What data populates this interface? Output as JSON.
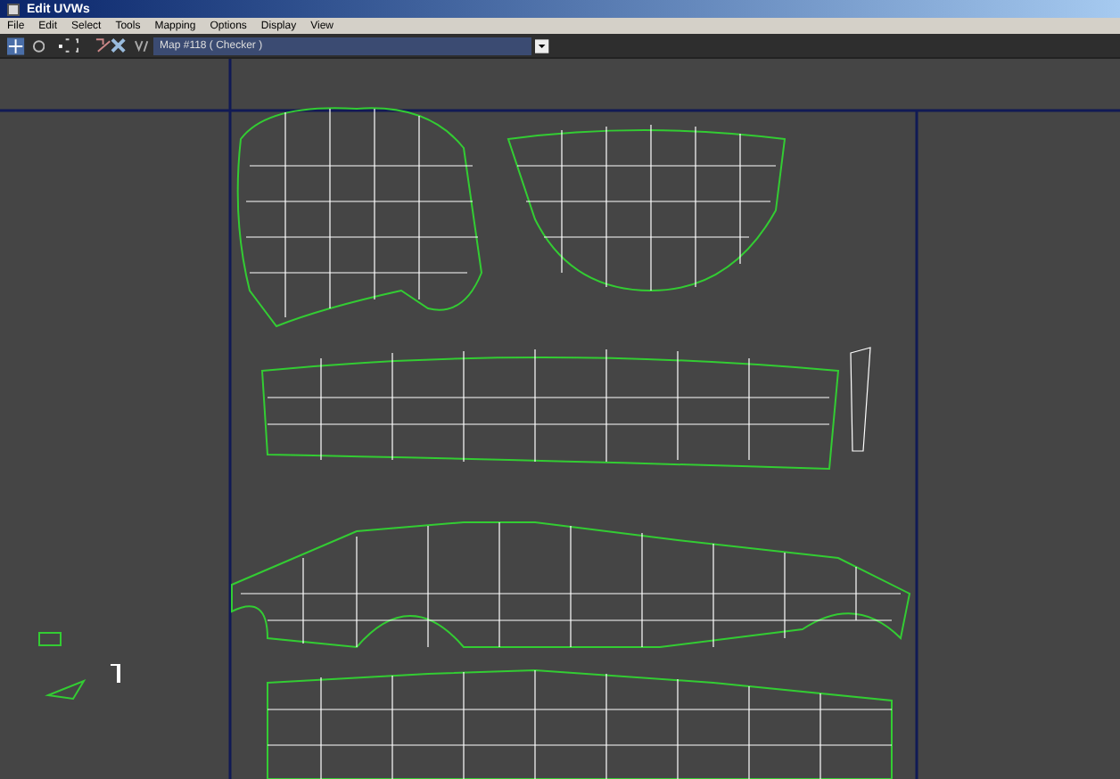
{
  "window": {
    "title": "Edit UVWs"
  },
  "menu": [
    "File",
    "Edit",
    "Select",
    "Tools",
    "Mapping",
    "Options",
    "Display",
    "View"
  ],
  "toolbar": {
    "map_dropdown": "Map #118 ( Checker )"
  }
}
